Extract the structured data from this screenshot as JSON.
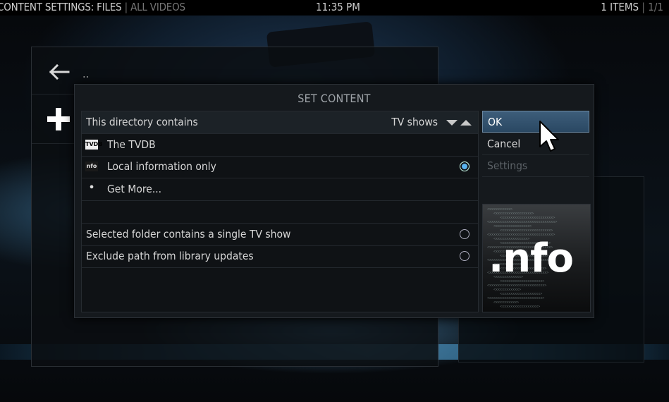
{
  "topbar": {
    "section": "CONTENT SETTINGS: FILES",
    "separator": "|",
    "subsection": "ALL VIDEOS",
    "clock": "11:35 PM",
    "items_count": "1 ITEMS",
    "page": "1/1"
  },
  "background_list": {
    "parent_label": ".."
  },
  "dialog": {
    "title": "SET CONTENT",
    "content_type": {
      "label": "This directory contains",
      "value": "TV shows"
    },
    "scrapers": [
      {
        "icon_text": "TVDB",
        "label": "The TVDB",
        "selected": false
      },
      {
        "icon_text": "nfo",
        "label": "Local information only",
        "selected": true
      },
      {
        "icon_text": "•",
        "label": "Get More...",
        "selected": false
      }
    ],
    "options": [
      {
        "label": "Selected folder contains a single TV show",
        "checked": false
      },
      {
        "label": "Exclude path from library updates",
        "checked": false
      }
    ],
    "buttons": {
      "ok": "OK",
      "cancel": "Cancel",
      "settings": "Settings"
    },
    "preview_text": ".nfo"
  },
  "colors": {
    "accent": "#5ab4ee",
    "focus_button": "#3d5d7a",
    "dialog_bg": "#15191d"
  },
  "icons": [
    "back-arrow-icon",
    "add-icon",
    "spinner-down-icon",
    "spinner-up-icon",
    "mouse-cursor-icon"
  ]
}
